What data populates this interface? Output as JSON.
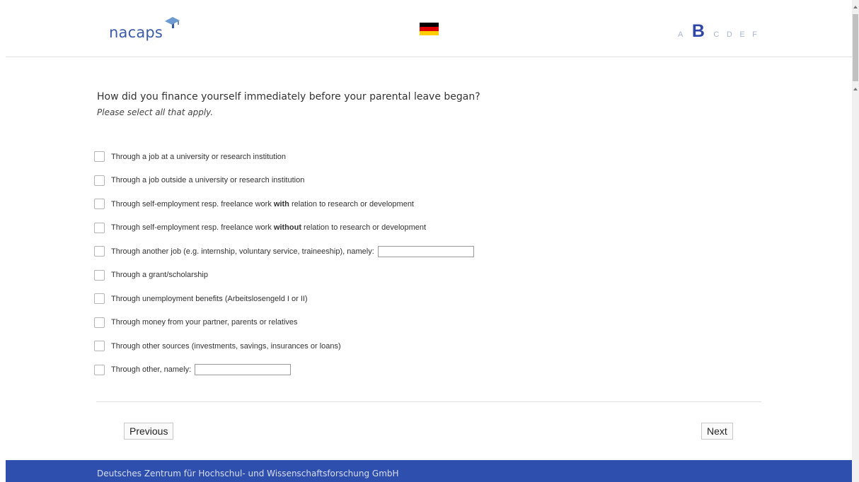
{
  "header": {
    "logo_text": "nacaps",
    "language_flag": "german-flag-icon",
    "steps": [
      {
        "label": "A",
        "active": false
      },
      {
        "label": "B",
        "active": true
      },
      {
        "label": "C",
        "active": false
      },
      {
        "label": "D",
        "active": false
      },
      {
        "label": "E",
        "active": false
      },
      {
        "label": "F",
        "active": false
      }
    ]
  },
  "question": {
    "title": "How did you finance yourself immediately before your parental leave began?",
    "hint": "Please select all that apply."
  },
  "options": [
    {
      "text": "Through a job at a university or research institution"
    },
    {
      "text": "Through a job outside a university or research institution"
    },
    {
      "pre": "Through self-employment resp. freelance work ",
      "bold": "with",
      "post": " relation to research or development"
    },
    {
      "pre": "Through self-employment resp. freelance work ",
      "bold": "without",
      "post": " relation to research or development"
    },
    {
      "text": "Through another job (e.g. internship, voluntary service, traineeship), namely:",
      "text_input": ""
    },
    {
      "text": "Through a grant/scholarship"
    },
    {
      "text": "Through unemployment benefits (Arbeitslosengeld I or II)"
    },
    {
      "text": "Through money from your partner, parents or relatives"
    },
    {
      "text": "Through other sources (investments, savings, insurances or loans)"
    },
    {
      "text": "Through other, namely:",
      "text_input": ""
    }
  ],
  "nav": {
    "previous_label": "Previous",
    "next_label": "Next"
  },
  "footer": {
    "text": "Deutsches Zentrum für Hochschul- und Wissenschaftsforschung GmbH"
  },
  "colors": {
    "brand_blue": "#2e4fae",
    "step_active": "#2d46a8",
    "step_inactive": "#aab4d8"
  }
}
